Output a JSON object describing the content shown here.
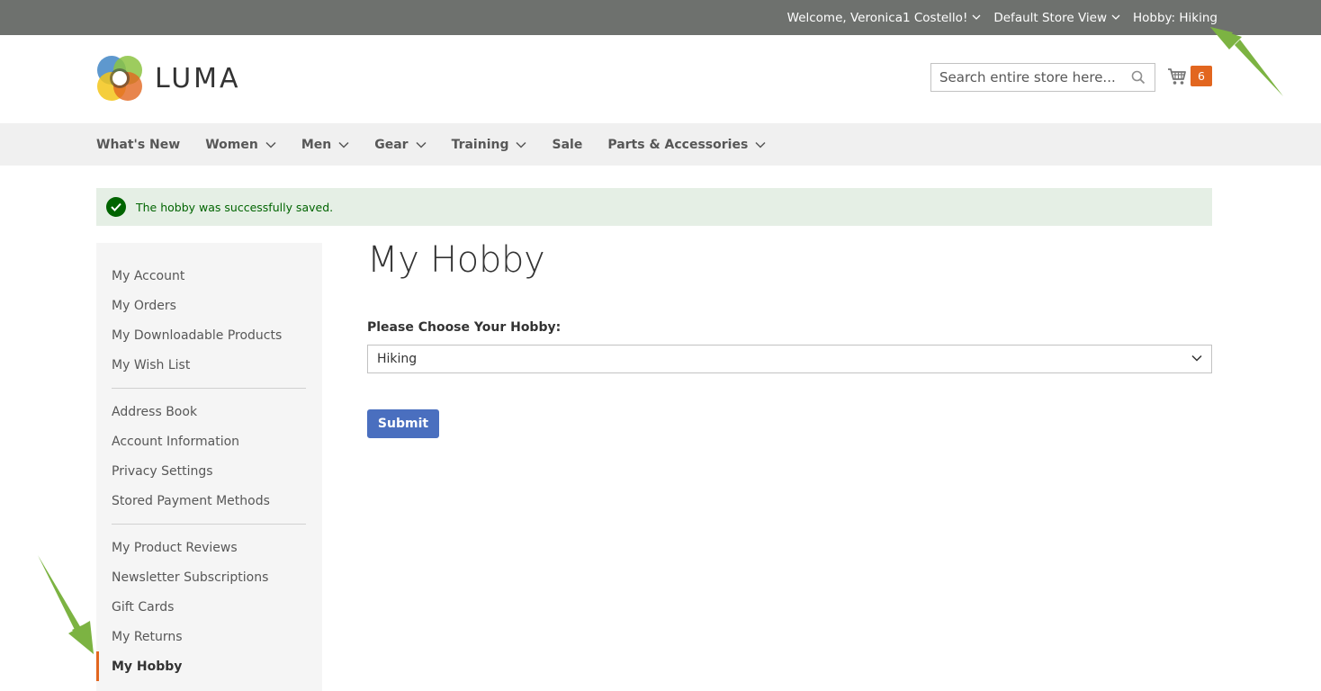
{
  "top_panel": {
    "welcome": "Welcome, Veronica1 Costello!",
    "store_view": "Default Store View",
    "hobby": "Hobby: Hiking"
  },
  "header": {
    "logo_text": "LUMA",
    "search_placeholder": "Search entire store here...",
    "cart_count": "6"
  },
  "nav": {
    "items": [
      {
        "label": "What's New",
        "has_children": false
      },
      {
        "label": "Women",
        "has_children": true
      },
      {
        "label": "Men",
        "has_children": true
      },
      {
        "label": "Gear",
        "has_children": true
      },
      {
        "label": "Training",
        "has_children": true
      },
      {
        "label": "Sale",
        "has_children": false
      },
      {
        "label": "Parts & Accessories",
        "has_children": true
      }
    ]
  },
  "message": {
    "text": "The hobby was successfully saved.",
    "type": "success"
  },
  "sidebar": {
    "group1": [
      "My Account",
      "My Orders",
      "My Downloadable Products",
      "My Wish List"
    ],
    "group2": [
      "Address Book",
      "Account Information",
      "Privacy Settings",
      "Stored Payment Methods"
    ],
    "group3": [
      "My Product Reviews",
      "Newsletter Subscriptions",
      "Gift Cards",
      "My Returns"
    ],
    "active": "My Hobby"
  },
  "main": {
    "title": "My Hobby",
    "field_label": "Please Choose Your Hobby:",
    "selected_hobby": "Hiking",
    "submit_label": "Submit"
  },
  "colors": {
    "top_panel_bg": "#6e716e",
    "nav_bg": "#f0f0f0",
    "accent_orange": "#e2661f",
    "button_blue": "#4a6fbf",
    "success_bg": "#e5efe5",
    "success_text": "#006400",
    "annotation_arrow": "#7cb342"
  }
}
